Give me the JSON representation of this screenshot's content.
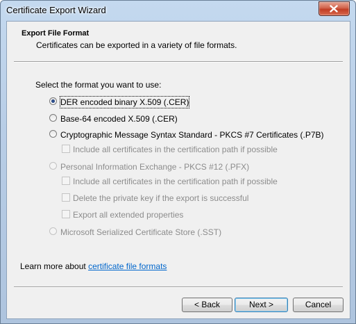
{
  "window": {
    "title": "Certificate Export Wizard"
  },
  "header": {
    "title": "Export File Format",
    "subtitle": "Certificates can be exported in a variety of file formats."
  },
  "prompt": "Select the format you want to use:",
  "options": [
    {
      "id": "der",
      "label": "DER encoded binary X.509 (.CER)",
      "checked": true,
      "enabled": true
    },
    {
      "id": "base64",
      "label": "Base-64 encoded X.509 (.CER)",
      "checked": false,
      "enabled": true
    },
    {
      "id": "pkcs7",
      "label": "Cryptographic Message Syntax Standard - PKCS #7 Certificates (.P7B)",
      "checked": false,
      "enabled": true
    },
    {
      "id": "pfx",
      "label": "Personal Information Exchange - PKCS #12 (.PFX)",
      "checked": false,
      "enabled": false
    },
    {
      "id": "sst",
      "label": "Microsoft Serialized Certificate Store (.SST)",
      "checked": false,
      "enabled": false
    }
  ],
  "checkboxes": {
    "pkcs7_include": "Include all certificates in the certification path if possible",
    "pfx_include": "Include all certificates in the certification path if possible",
    "pfx_delete_key": "Delete the private key if the export is successful",
    "pfx_export_props": "Export all extended properties"
  },
  "learn_more": {
    "prefix": "Learn more about ",
    "link": "certificate file formats"
  },
  "buttons": {
    "back": "< Back",
    "next": "Next >",
    "cancel": "Cancel"
  }
}
